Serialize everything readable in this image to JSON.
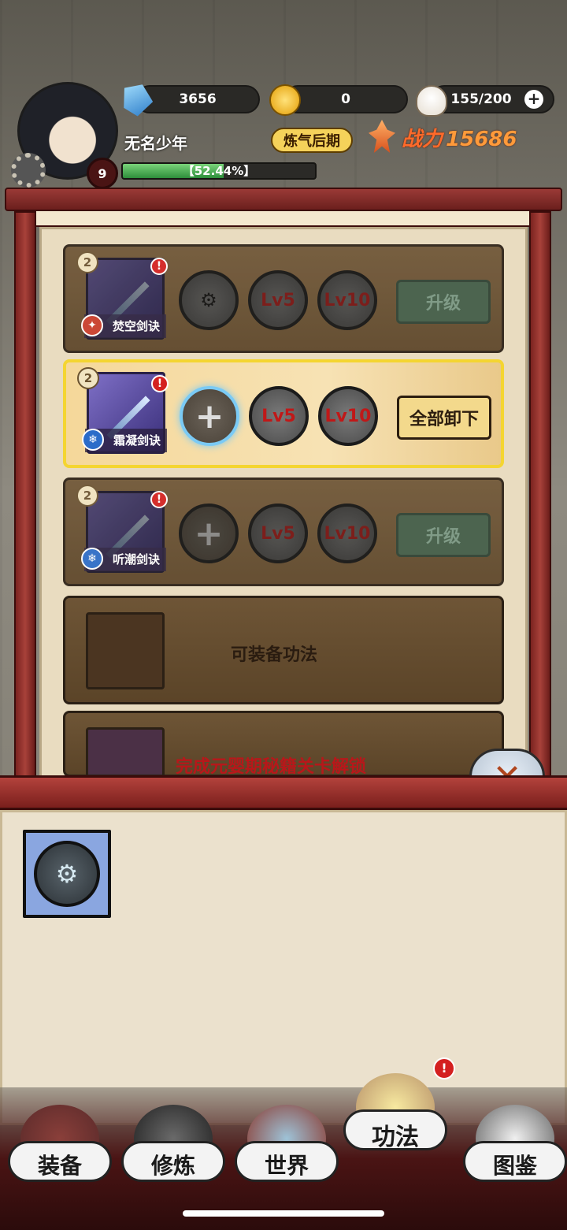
{
  "hud": {
    "gems": "3656",
    "coins": "0",
    "stamina": "155/200",
    "player_name": "无名少年",
    "level": "9",
    "realm": "炼气后期",
    "power_label": "战力",
    "power_value": "15686",
    "exp_text": "【52.44%】",
    "exp_progress": 0.5244
  },
  "slots": [
    {
      "rank": "2",
      "name": "焚空剑诀",
      "element": "fire",
      "lv5": "Lv5",
      "lv10": "Lv10",
      "button": "升级",
      "state": "dim"
    },
    {
      "rank": "2",
      "name": "霜凝剑诀",
      "element": "ice",
      "lv5": "Lv5",
      "lv10": "Lv10",
      "button": "全部卸下",
      "state": "active"
    },
    {
      "rank": "2",
      "name": "听潮剑诀",
      "element": "ice",
      "lv5": "Lv5",
      "lv10": "Lv10",
      "button": "升级",
      "state": "dim"
    }
  ],
  "empty_slot_text": "可装备功法",
  "locked_slot_text": "完成元婴期秘籍关卡解锁",
  "nav": [
    {
      "label": "装备",
      "icon": "equipment-icon"
    },
    {
      "label": "修炼",
      "icon": "cultivation-icon"
    },
    {
      "label": "世界",
      "icon": "world-map-icon"
    },
    {
      "label": "功法",
      "icon": "scroll-books-icon",
      "selected": true
    },
    {
      "label": "图鉴",
      "icon": "open-book-icon"
    }
  ],
  "colors": {
    "frame_red": "#9a3a36",
    "active_border": "#f4d531",
    "alert_red": "#d42020",
    "power_orange": "#ff6a2a"
  }
}
